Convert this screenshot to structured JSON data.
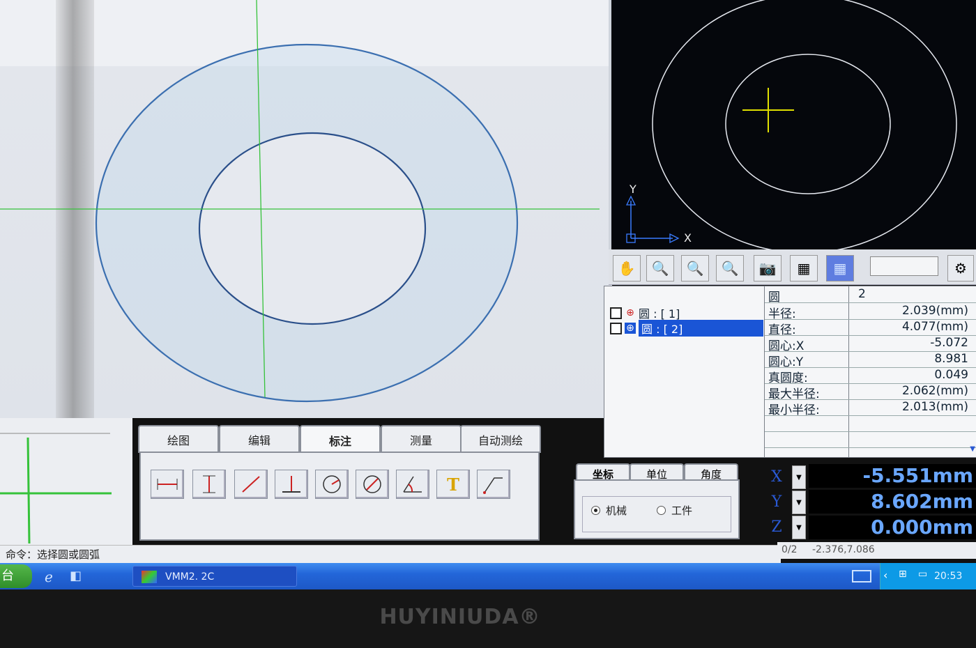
{
  "cad_view": {
    "axis_y": "Y",
    "axis_x": "X"
  },
  "toolbar": {
    "icons": [
      "pan-hand-icon",
      "zoom-in-icon",
      "zoom-window-icon",
      "zoom-out-icon",
      "camera-icon",
      "layout-icon",
      "grid-icon",
      "settings-icon"
    ]
  },
  "feature_tree": {
    "items": [
      {
        "label": "圆 : [ 1]",
        "selected": false
      },
      {
        "label": "圆 : [ 2]",
        "selected": true
      }
    ]
  },
  "properties": {
    "header": {
      "key": "圆",
      "value": "2"
    },
    "rows": [
      {
        "key": "半径:",
        "value": "2.039(mm)"
      },
      {
        "key": "直径:",
        "value": "4.077(mm)"
      },
      {
        "key": "圆心:X",
        "value": "-5.072"
      },
      {
        "key": "圆心:Y",
        "value": "8.981"
      },
      {
        "key": "真圆度:",
        "value": "0.049"
      },
      {
        "key": "最大半径:",
        "value": "2.062(mm)"
      },
      {
        "key": "最小半径:",
        "value": "2.013(mm)"
      }
    ]
  },
  "tool_tabs": {
    "tabs": [
      "绘图",
      "编辑",
      "标注",
      "测量",
      "自动测绘"
    ],
    "active": "标注"
  },
  "tools": [
    "horizontal-dimension-icon",
    "vertical-dimension-icon",
    "aligned-dimension-icon",
    "baseline-dimension-icon",
    "radius-dimension-icon",
    "diameter-dimension-icon",
    "angle-dimension-icon",
    "text-tool-icon",
    "leader-tool-icon"
  ],
  "coord_settings": {
    "tabs": [
      "坐标",
      "单位",
      "角度"
    ],
    "active": "坐标",
    "options": [
      {
        "label": "机械",
        "checked": true
      },
      {
        "label": "工件",
        "checked": false
      }
    ]
  },
  "dro": {
    "x_label": "X",
    "x_value": "-5.551mm",
    "y_label": "Y",
    "y_value": "8.602mm",
    "z_label": "Z",
    "z_value": "0.000mm"
  },
  "status": {
    "command": "命令：选择圆或圆弧",
    "counter": "0/2",
    "cursor_coords": "-2.376,7.086"
  },
  "taskbar": {
    "task": "VMM2. 2C",
    "clock": "20:53"
  },
  "monitor": {
    "brand": "HUYINIUDA®"
  },
  "colors": {
    "crosshair": "#35c23a",
    "circle_edge": "#3b6fb0",
    "dro_text": "#6aa7ff",
    "selection": "#1a55d6"
  }
}
